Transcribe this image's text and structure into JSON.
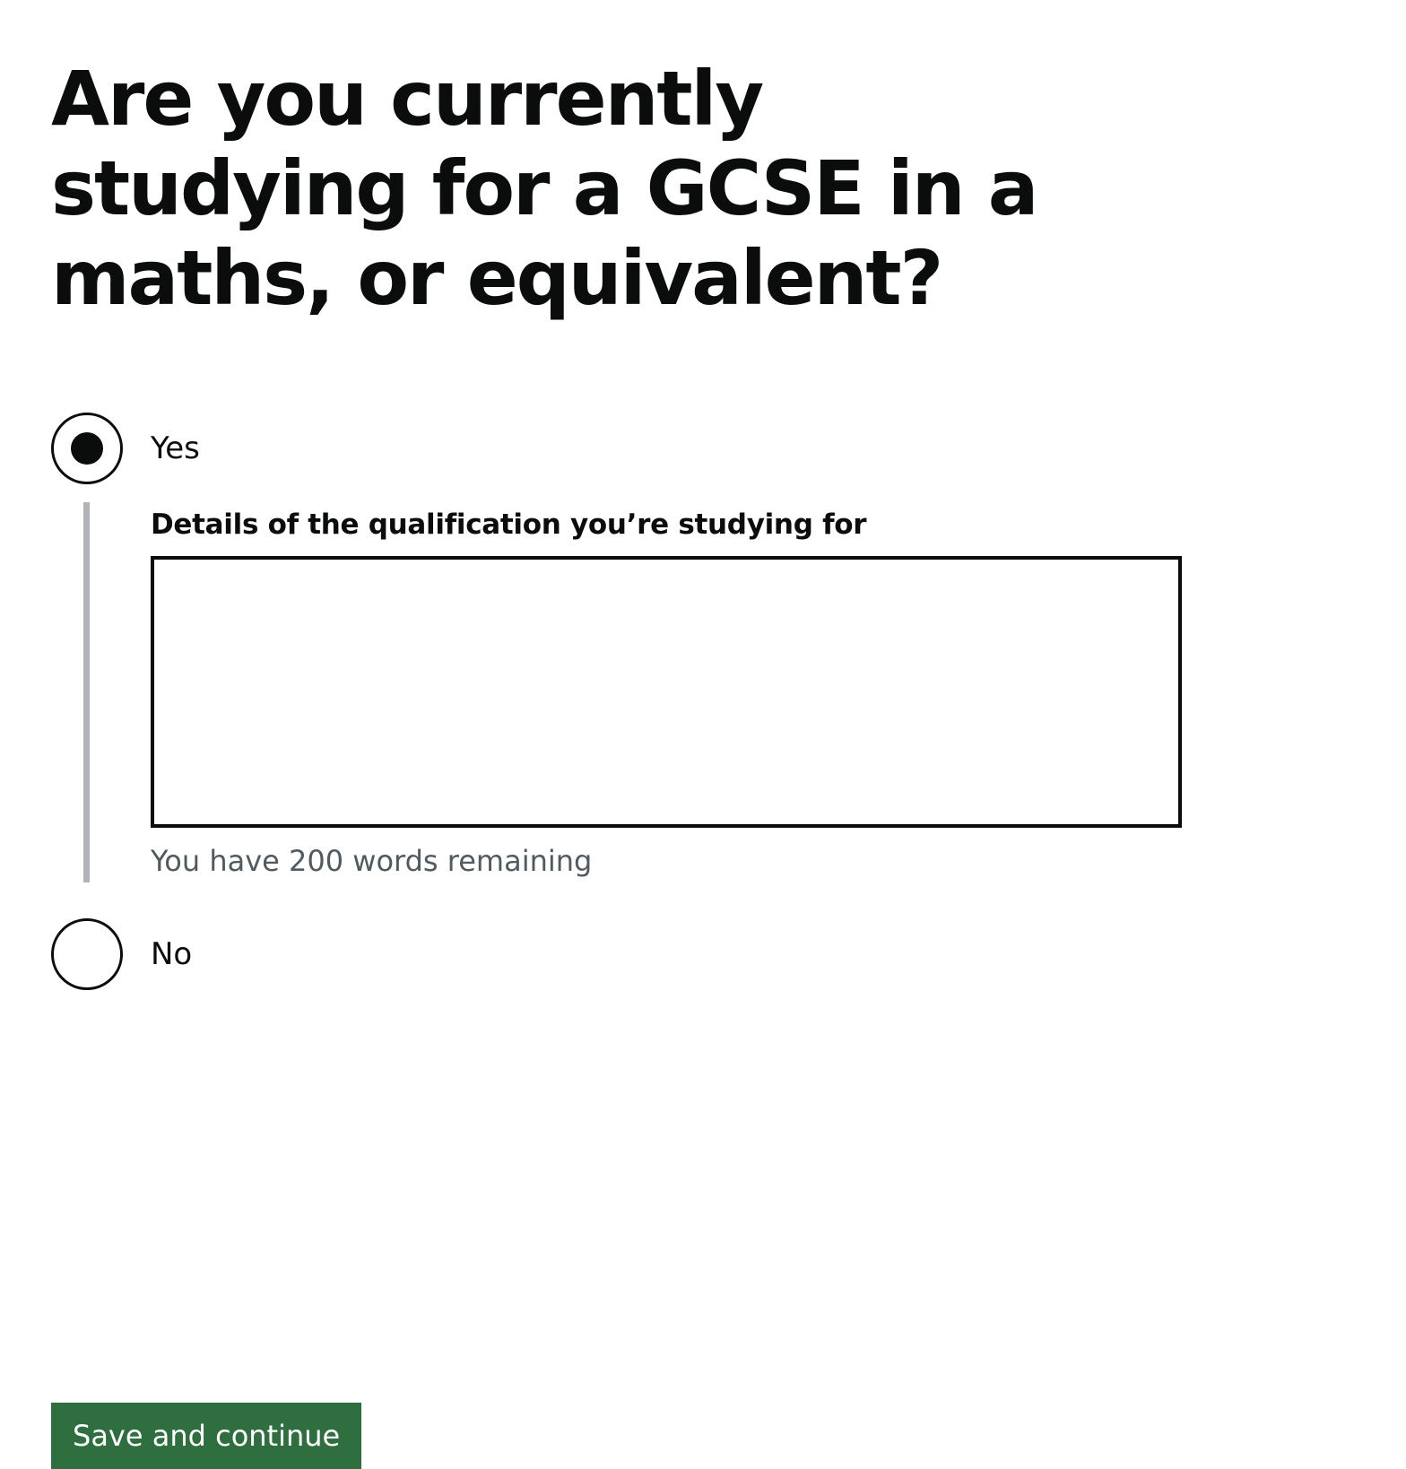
{
  "question": {
    "heading": "Are you currently studying for a GCSE in a maths, or equivalent?"
  },
  "options": {
    "yes": {
      "label": "Yes",
      "selected": true
    },
    "no": {
      "label": "No",
      "selected": false
    }
  },
  "conditional": {
    "label": "Details of the qualification you’re studying for",
    "textarea_value": "",
    "hint": "You have 200 words remaining"
  },
  "actions": {
    "save_label": "Save and continue"
  },
  "colors": {
    "text": "#0b0c0c",
    "button_green": "#2f6f3f",
    "button_shadow": "#002d18",
    "hint_grey": "#505a5f",
    "conditional_border": "#b1b4b6"
  }
}
